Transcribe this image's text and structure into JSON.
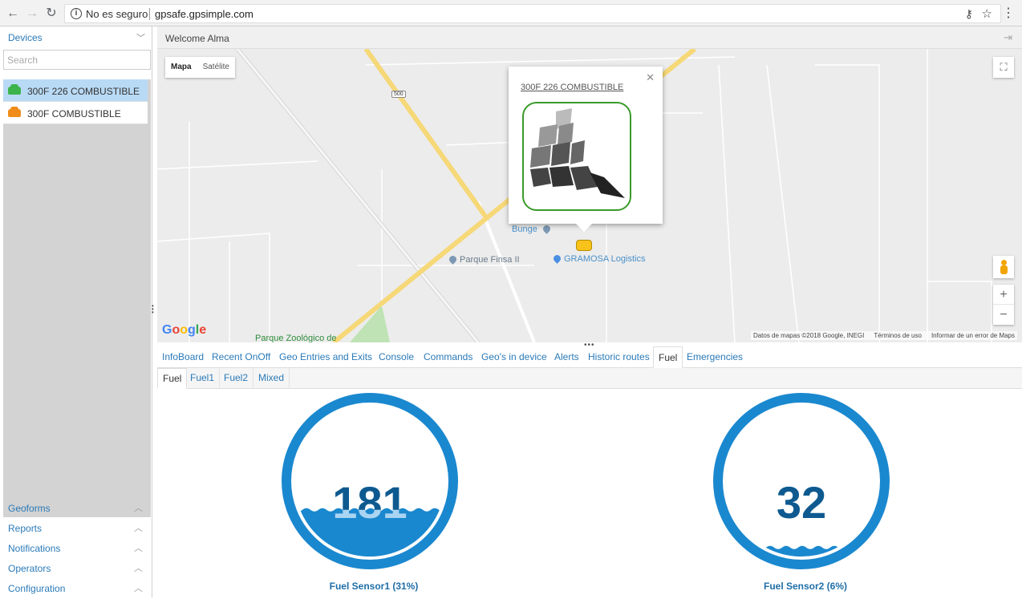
{
  "browser": {
    "security": "No es seguro",
    "url": "gpsafe.gpsimple.com",
    "back_icon": "back-arrow-icon",
    "forward_icon": "forward-arrow-icon",
    "reload_icon": "reload-icon"
  },
  "sidebar": {
    "devices_title": "Devices",
    "search_placeholder": "Search",
    "devices": [
      {
        "label": "300F 226 COMBUSTIBLE",
        "color": "#3cb44b",
        "selected": true
      },
      {
        "label": "300F COMBUSTIBLE",
        "color": "#f08c1a",
        "selected": false
      }
    ],
    "menus": [
      {
        "label": "Geoforms"
      },
      {
        "label": "Reports"
      },
      {
        "label": "Notifications"
      },
      {
        "label": "Operators"
      },
      {
        "label": "Configuration"
      }
    ]
  },
  "header": {
    "welcome": "Welcome Alma"
  },
  "map": {
    "type_map": "Mapa",
    "type_satellite": "Satélite",
    "road_shield": "500",
    "pois": {
      "bunge": "Bunge",
      "parque_finsa": "Parque Finsa II",
      "gramosa": "GRAMOSA Logistics",
      "zoologico": "Parque Zoológico de"
    },
    "popup_title": "300F 226 COMBUSTIBLE",
    "attribution": [
      "Datos de mapas ©2018 Google, INEGI",
      "Términos de uso",
      "Informar de un error de Maps"
    ],
    "zoom_in": "+",
    "zoom_out": "−"
  },
  "tabs": [
    {
      "label": "InfoBoard"
    },
    {
      "label": "Recent OnOff"
    },
    {
      "label": "Geo Entries and Exits"
    },
    {
      "label": "Console"
    },
    {
      "label": "Commands"
    },
    {
      "label": "Geo's in device"
    },
    {
      "label": "Alerts"
    },
    {
      "label": "Historic routes"
    },
    {
      "label": "Fuel",
      "active": true
    },
    {
      "label": "Emergencies"
    }
  ],
  "subtabs": [
    {
      "label": "Fuel",
      "active": true
    },
    {
      "label": "Fuel1"
    },
    {
      "label": "Fuel2"
    },
    {
      "label": "Mixed"
    }
  ],
  "gauges": [
    {
      "value": "181",
      "label": "Fuel Sensor1 (31%)",
      "fill_fraction": 0.31
    },
    {
      "value": "32",
      "label": "Fuel Sensor2 (6%)",
      "fill_fraction": 0.06
    }
  ],
  "colors": {
    "accent": "#2a7ab8",
    "gauge_blue": "#1a88cf",
    "selected_row": "#b9daf5"
  }
}
